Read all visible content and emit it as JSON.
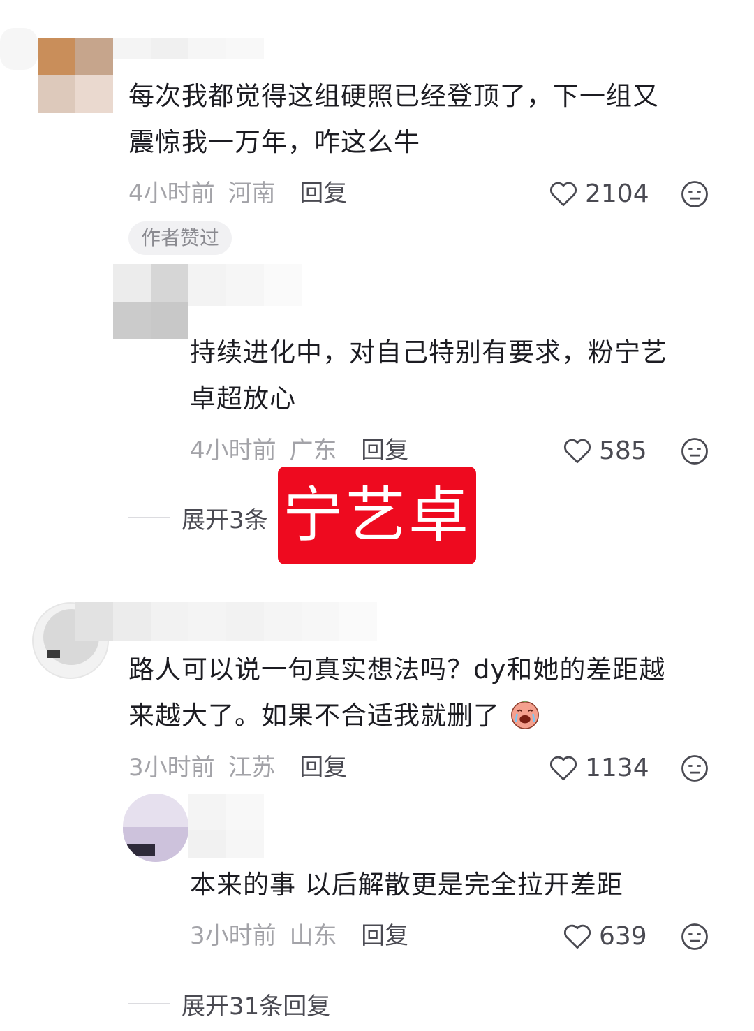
{
  "comments": [
    {
      "text_line1": "每次我都觉得这组硬照已经登顶了，下一组又",
      "text_line2": "震惊我一万年，咋这么牛",
      "time": "4小时前",
      "location": "河南",
      "reply_label": "回复",
      "likes": "2104",
      "badge": "作者赞过",
      "reply": {
        "text_line1": "持续进化中，对自己特别有要求，粉宁艺",
        "text_line2": "卓超放心",
        "time": "4小时前",
        "location": "广东",
        "reply_label": "回复",
        "likes": "585"
      },
      "expand_label": "展开3条"
    },
    {
      "text_line1": "路人可以说一句真实想法吗？dy和她的差距越",
      "text_line2": "来越大了。如果不合适我就删了",
      "emoji": "crying-face-emoji",
      "time": "3小时前",
      "location": "江苏",
      "reply_label": "回复",
      "likes": "1134",
      "reply": {
        "text_line1": "本来的事 以后解散更是完全拉开差距",
        "time": "3小时前",
        "location": "山东",
        "reply_label": "回复",
        "likes": "639"
      },
      "expand_label": "展开31条回复"
    }
  ],
  "watermark": "宁艺卓",
  "colors": {
    "watermark_bg": "#ee0a1f",
    "meta_text": "#a3a3a8",
    "body_text": "#1c1c22"
  },
  "icons": [
    "heart-outline-icon",
    "dislike-face-icon"
  ]
}
